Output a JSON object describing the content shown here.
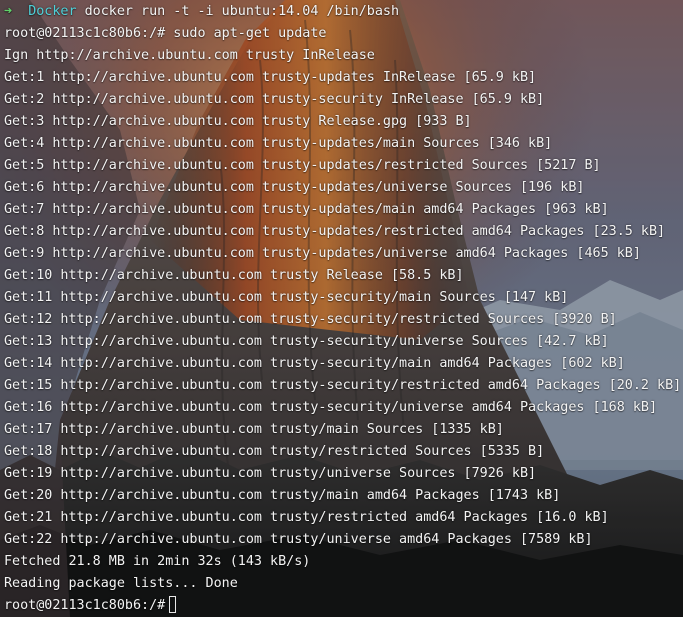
{
  "prompt_line": {
    "arrow": "➜",
    "cwd": "Docker",
    "command": "docker run -t -i ubuntu:14.04 /bin/bash"
  },
  "lines": [
    "root@02113c1c80b6:/# sudo apt-get update",
    "Ign http://archive.ubuntu.com trusty InRelease",
    "Get:1 http://archive.ubuntu.com trusty-updates InRelease [65.9 kB]",
    "Get:2 http://archive.ubuntu.com trusty-security InRelease [65.9 kB]",
    "Get:3 http://archive.ubuntu.com trusty Release.gpg [933 B]",
    "Get:4 http://archive.ubuntu.com trusty-updates/main Sources [346 kB]",
    "Get:5 http://archive.ubuntu.com trusty-updates/restricted Sources [5217 B]",
    "Get:6 http://archive.ubuntu.com trusty-updates/universe Sources [196 kB]",
    "Get:7 http://archive.ubuntu.com trusty-updates/main amd64 Packages [963 kB]",
    "Get:8 http://archive.ubuntu.com trusty-updates/restricted amd64 Packages [23.5 kB]",
    "Get:9 http://archive.ubuntu.com trusty-updates/universe amd64 Packages [465 kB]",
    "Get:10 http://archive.ubuntu.com trusty Release [58.5 kB]",
    "Get:11 http://archive.ubuntu.com trusty-security/main Sources [147 kB]",
    "Get:12 http://archive.ubuntu.com trusty-security/restricted Sources [3920 B]",
    "Get:13 http://archive.ubuntu.com trusty-security/universe Sources [42.7 kB]",
    "Get:14 http://archive.ubuntu.com trusty-security/main amd64 Packages [602 kB]",
    "Get:15 http://archive.ubuntu.com trusty-security/restricted amd64 Packages [20.2 kB]",
    "Get:16 http://archive.ubuntu.com trusty-security/universe amd64 Packages [168 kB]",
    "Get:17 http://archive.ubuntu.com trusty/main Sources [1335 kB]",
    "Get:18 http://archive.ubuntu.com trusty/restricted Sources [5335 B]",
    "Get:19 http://archive.ubuntu.com trusty/universe Sources [7926 kB]",
    "Get:20 http://archive.ubuntu.com trusty/main amd64 Packages [1743 kB]",
    "Get:21 http://archive.ubuntu.com trusty/restricted amd64 Packages [16.0 kB]",
    "Get:22 http://archive.ubuntu.com trusty/universe amd64 Packages [7589 kB]",
    "Fetched 21.8 MB in 2min 32s (143 kB/s)",
    "Reading package lists... Done"
  ],
  "final_prompt": "root@02113c1c80b6:/#",
  "colors": {
    "text": "#f4f4f4",
    "arrow": "#5fd46a",
    "cwd": "#4fd1d9"
  }
}
